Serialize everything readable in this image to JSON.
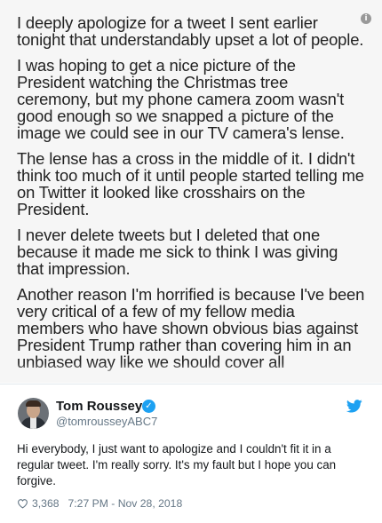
{
  "note": {
    "paragraphs": [
      "I deeply apologize for a tweet I sent earlier tonight that understandably upset a lot of people.",
      "I was hoping to get a nice picture of the President watching the Christmas tree ceremony, but my phone camera zoom wasn't good enough so we snapped a picture of the image we could see in our TV camera's lense.",
      "The lense has a cross in the middle of it.  I didn't think too much of it until people started telling me on Twitter it looked like crosshairs on the President.",
      "I never delete tweets but I deleted that one because it made me sick to think I was giving that impression.",
      "Another reason I'm horrified is because I've been very critical of a few of my fellow media members who have shown obvious bias against President Trump rather than covering him in an unbiased way like we should cover all"
    ],
    "info_icon": "i"
  },
  "tweet": {
    "author_name": "Tom Roussey",
    "handle": "@tomrousseyABC7",
    "verified_icon": "✓",
    "text": "Hi everybody, I just want to apologize and I couldn't fit it in a regular tweet. I'm really sorry. It's my fault but I hope you can forgive.",
    "likes": "3,368",
    "timestamp": "7:27 PM - Nov 28, 2018"
  },
  "icons": {
    "info": "info-icon",
    "verified": "verified-badge-icon",
    "bird": "twitter-bird-icon",
    "heart": "heart-icon"
  },
  "colors": {
    "accent": "#1da1f2",
    "muted": "#657786",
    "text": "#14171a",
    "note_background": "#f6f6f6"
  }
}
